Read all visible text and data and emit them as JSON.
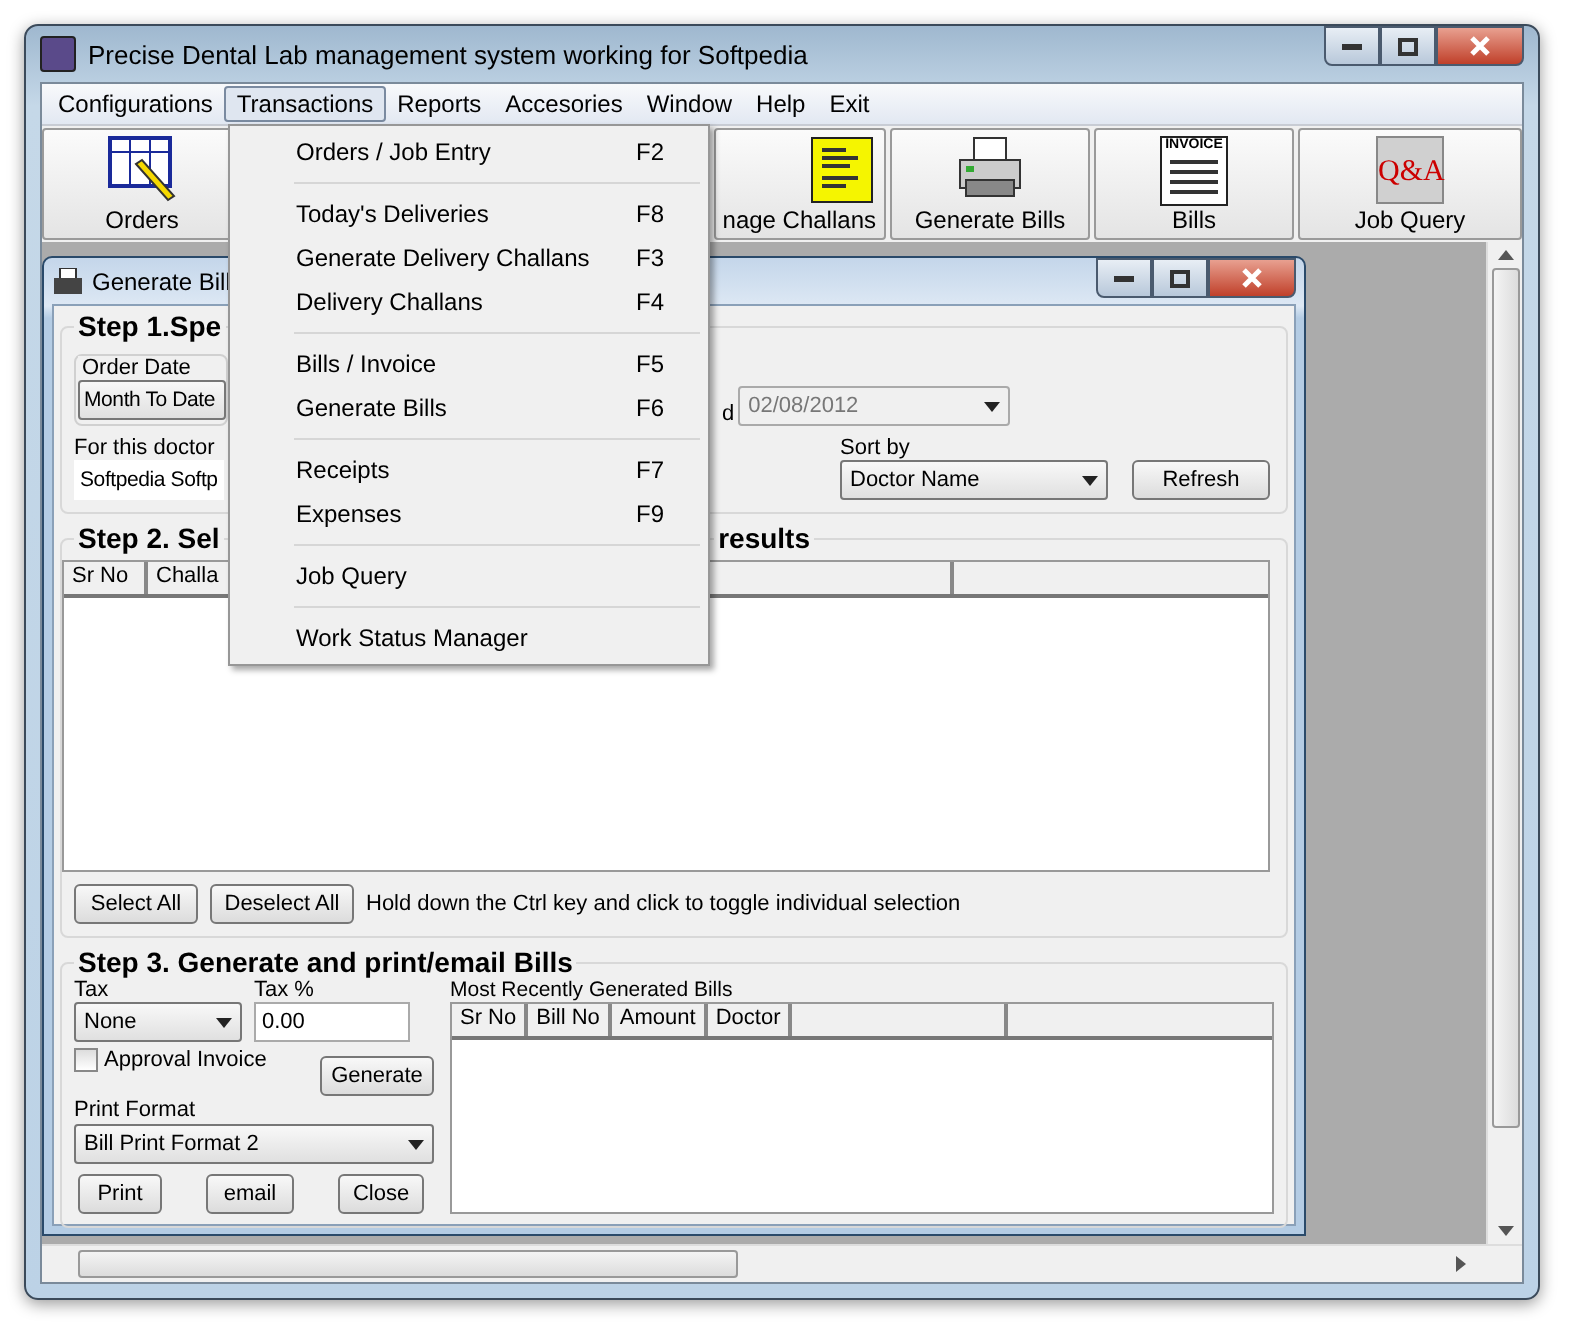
{
  "window": {
    "title": "Precise Dental Lab management system working for Softpedia"
  },
  "menu_bar": [
    {
      "label": "Configurations",
      "selected": false
    },
    {
      "label": "Transactions",
      "selected": true
    },
    {
      "label": "Reports",
      "selected": false
    },
    {
      "label": "Accesories",
      "selected": false
    },
    {
      "label": "Window",
      "selected": false
    },
    {
      "label": "Help",
      "selected": false
    },
    {
      "label": "Exit",
      "selected": false
    }
  ],
  "toolbar": [
    {
      "label": "Orders",
      "kind": "calendar"
    },
    {
      "label": "nage Challans",
      "kind": "challan"
    },
    {
      "label": "Generate Bills",
      "kind": "printer"
    },
    {
      "label": "Bills",
      "kind": "invoice",
      "icon_text": "INVOICE"
    },
    {
      "label": "Job Query",
      "kind": "qa",
      "icon_text": "Q&A"
    }
  ],
  "dropdown": [
    [
      {
        "label": "Orders / Job Entry",
        "shortcut": "F2"
      }
    ],
    [
      {
        "label": "Today's Deliveries",
        "shortcut": "F8"
      },
      {
        "label": "Generate Delivery Challans",
        "shortcut": "F3"
      },
      {
        "label": "Delivery Challans",
        "shortcut": "F4"
      }
    ],
    [
      {
        "label": "Bills / Invoice",
        "shortcut": "F5"
      },
      {
        "label": "Generate Bills",
        "shortcut": "F6"
      }
    ],
    [
      {
        "label": "Receipts",
        "shortcut": "F7"
      },
      {
        "label": "Expenses",
        "shortcut": "F9"
      }
    ],
    [
      {
        "label": "Job Query"
      }
    ],
    [
      {
        "label": "Work Status Manager"
      }
    ]
  ],
  "child_window": {
    "title": "Generate Bill",
    "step1": {
      "heading": "Step 1.Spe",
      "order_date_label": "Order Date",
      "period": "Month To Date",
      "end_label": "d",
      "end_date": "02/08/2012",
      "doctor_label": "For this doctor",
      "doctor": "Softpedia Softp",
      "sort_label": "Sort by",
      "sort": "Doctor Name",
      "refresh": "Refresh"
    },
    "step2": {
      "heading": "Step 2. Sel",
      "heading_tail": "results",
      "columns": [
        "Sr No",
        "Challa"
      ],
      "select_all": "Select All",
      "deselect_all": "Deselect All",
      "hint": "Hold down the Ctrl key and click to toggle individual selection"
    },
    "step3": {
      "heading": "Step 3. Generate and print/email  Bills",
      "tax_label": "Tax",
      "tax": "None",
      "tax_pct_label": "Tax %",
      "tax_pct": "0.00",
      "approval": {
        "label": "Approval Invoice",
        "checked": false
      },
      "generate": "Generate",
      "print_format_label": "Print Format",
      "print_format": "Bill Print Format 2",
      "print": "Print",
      "email": "email",
      "close": "Close",
      "recent_label": "Most Recently Generated Bills",
      "columns": [
        "Sr No",
        "Bill No",
        "Amount",
        "Doctor"
      ]
    }
  }
}
